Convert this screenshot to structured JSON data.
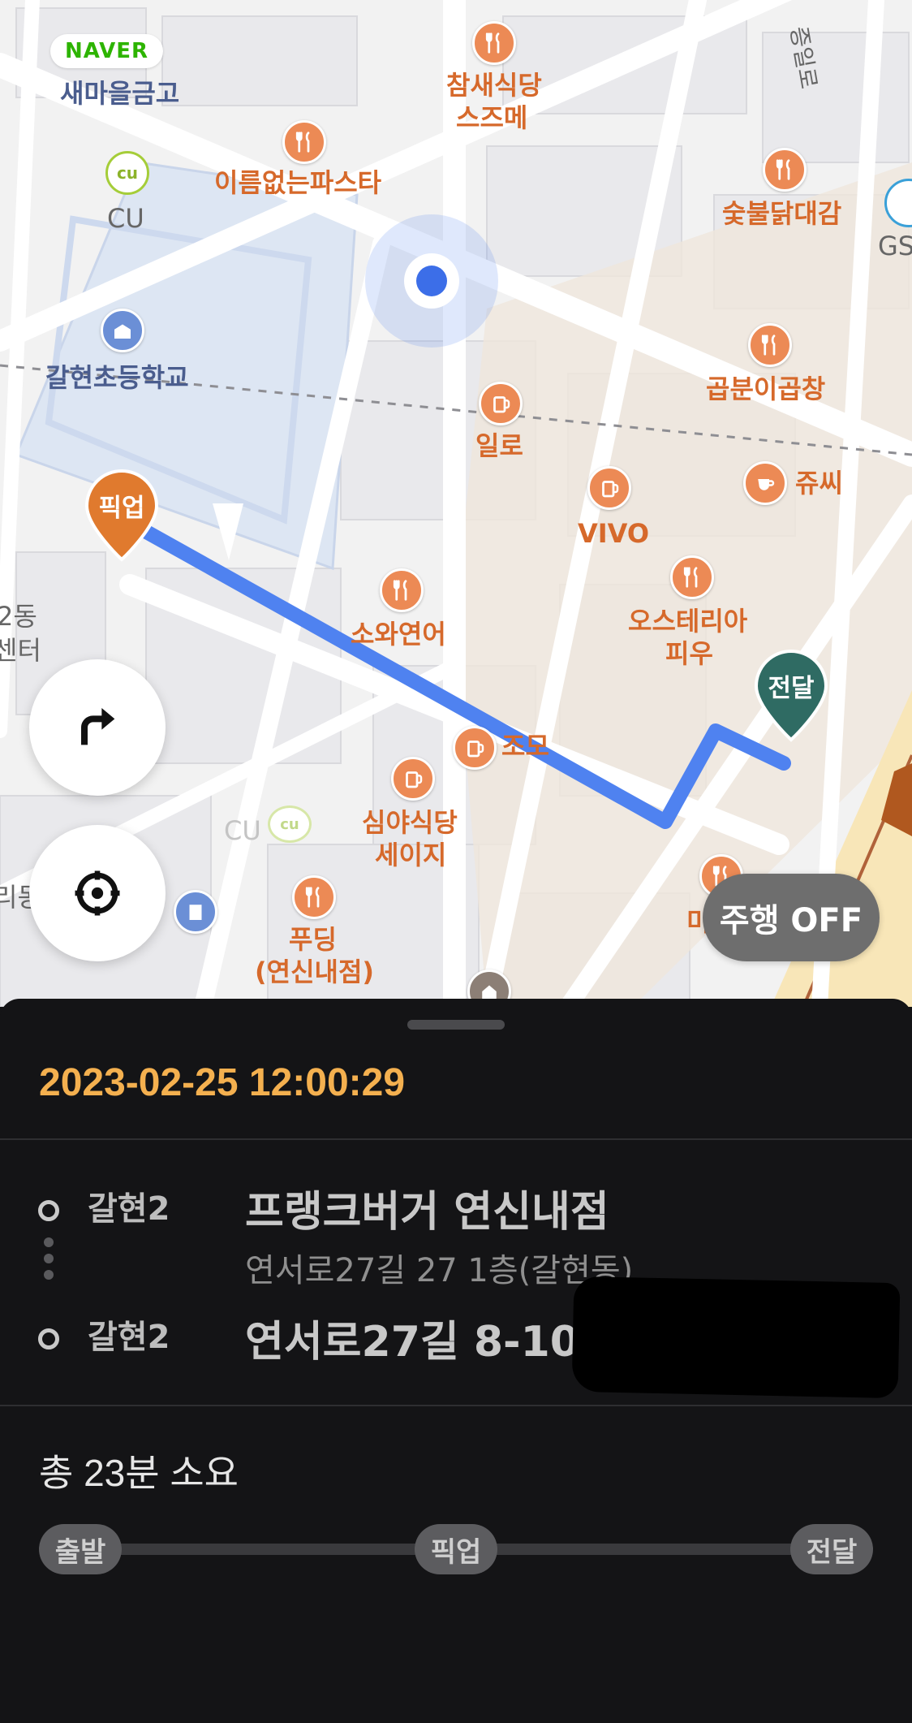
{
  "map": {
    "logo": "NAVER",
    "pickup_pin_label": "픽업",
    "delivery_pin_label": "전달",
    "drive_mode_label": "주행 OFF",
    "route_color": "#4f82f0",
    "pickup_color": "#e07a2e",
    "delivery_color": "#2f6b63",
    "places": {
      "saemaeul": "새마을금고",
      "cu_top": "CU",
      "chamsae_1": "참새식당",
      "chamsae_2": "스즈메",
      "ireum": "이름없는파스타",
      "sutbul": "숯불닭대감",
      "gs_partial": "GS",
      "road_partial": "증일로",
      "galhyeon": "갈현초등학교",
      "gopbun": "곱분이곱창",
      "illo": "일로",
      "jyussi": "쥬씨",
      "vivo": "VIVO",
      "osteria_1": "오스테리아",
      "osteria_2": "피우",
      "sowa": "소와연어",
      "left_2dong_1": "2동",
      "left_2dong_2": "센터",
      "jomo": "조모",
      "simya_1": "심야식당",
      "simya_2": "세이지",
      "cu_bottom": "CU",
      "left_ridong": "리동",
      "pudding_1": "푸딩",
      "pudding_2": "(연신내점)",
      "mi_partial": "미"
    }
  },
  "sheet": {
    "datetime": "2023-02-25 12:00:29",
    "pickup": {
      "area": "갈현2",
      "store_name": "프랭크버거 연신내점",
      "address": "연서로27길 27 1층(갈현동)"
    },
    "delivery": {
      "area": "갈현2",
      "address": "연서로27길 8-10"
    },
    "total_time": "총 23분 소요",
    "steps": [
      "출발",
      "픽업",
      "전달"
    ]
  }
}
